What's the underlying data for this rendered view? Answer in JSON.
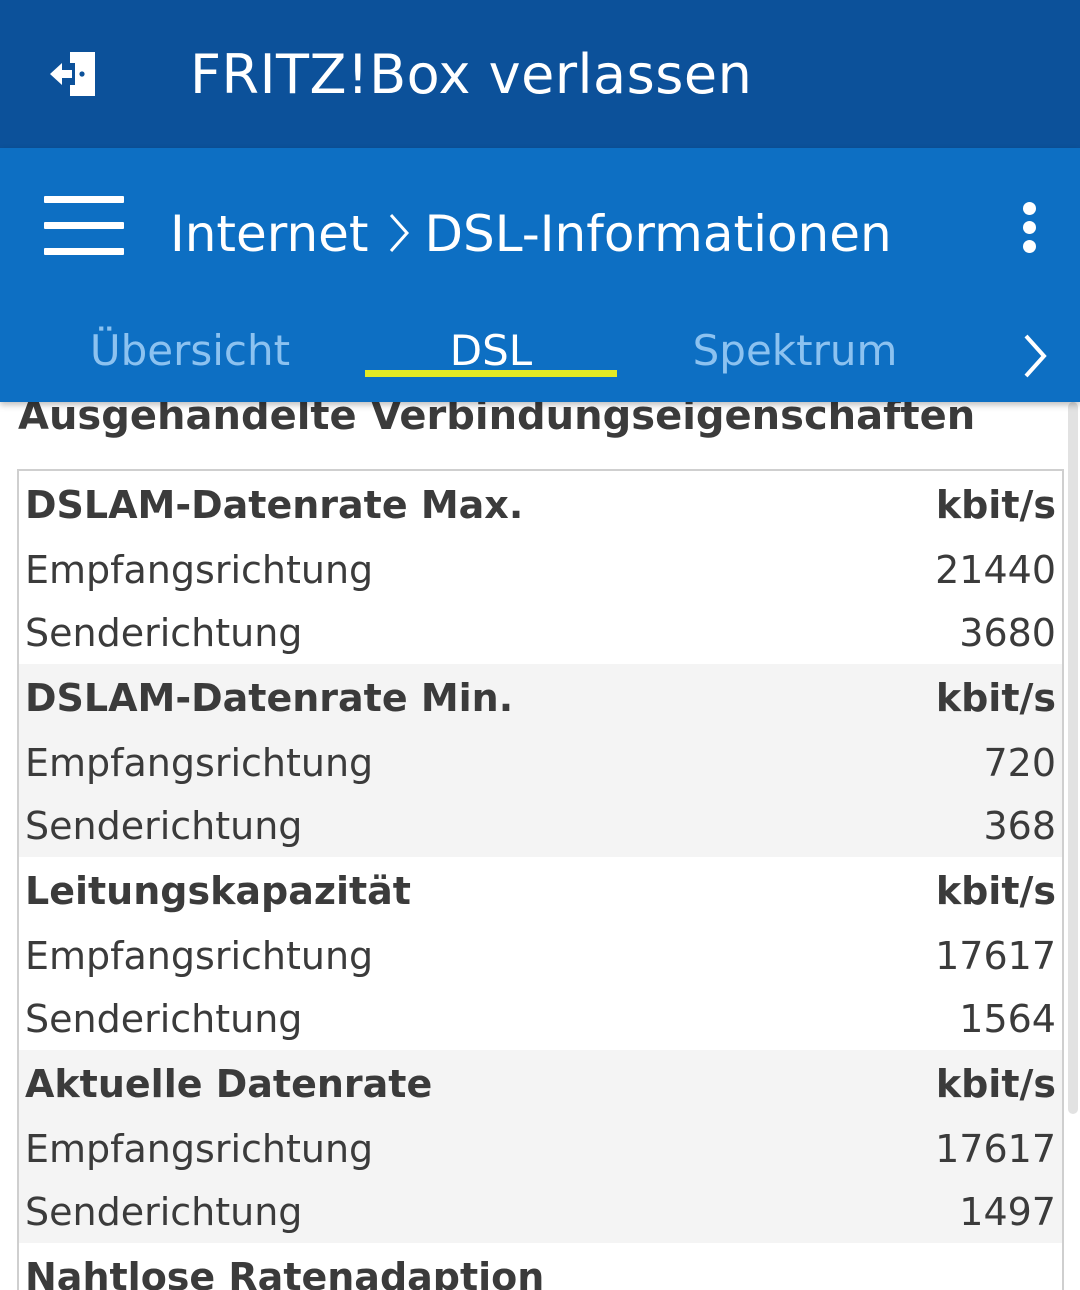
{
  "topbar": {
    "icon": "exit-door-icon",
    "title": "FRITZ!Box verlassen"
  },
  "header": {
    "menu_icon": "hamburger-menu-icon",
    "breadcrumb": {
      "parent": "Internet",
      "current": "DSL-Informationen"
    },
    "more_icon": "more-vertical-icon"
  },
  "tabs": [
    {
      "label": "Übersicht",
      "active": false
    },
    {
      "label": "DSL",
      "active": true
    },
    {
      "label": "Spektrum",
      "active": false
    }
  ],
  "colors": {
    "topbar": "#0c519a",
    "header": "#0d6fc3",
    "tab_inactive": "#8cc2f0",
    "tab_indicator": "#e3ea24"
  },
  "section_title": "Ausgehandelte Verbindungseigenschaften",
  "groups": [
    {
      "title": "DSLAM-Datenrate Max.",
      "unit": "kbit/s",
      "rows": [
        {
          "label": "Empfangsrichtung",
          "value": "21440"
        },
        {
          "label": "Senderichtung",
          "value": "3680"
        }
      ]
    },
    {
      "title": "DSLAM-Datenrate Min.",
      "unit": "kbit/s",
      "rows": [
        {
          "label": "Empfangsrichtung",
          "value": "720"
        },
        {
          "label": "Senderichtung",
          "value": "368"
        }
      ]
    },
    {
      "title": "Leitungskapazität",
      "unit": "kbit/s",
      "rows": [
        {
          "label": "Empfangsrichtung",
          "value": "17617"
        },
        {
          "label": "Senderichtung",
          "value": "1564"
        }
      ]
    },
    {
      "title": "Aktuelle Datenrate",
      "unit": "kbit/s",
      "rows": [
        {
          "label": "Empfangsrichtung",
          "value": "17617"
        },
        {
          "label": "Senderichtung",
          "value": "1497"
        }
      ]
    },
    {
      "title": "Nahtlose Ratenadaption",
      "unit": "",
      "rows": []
    }
  ]
}
